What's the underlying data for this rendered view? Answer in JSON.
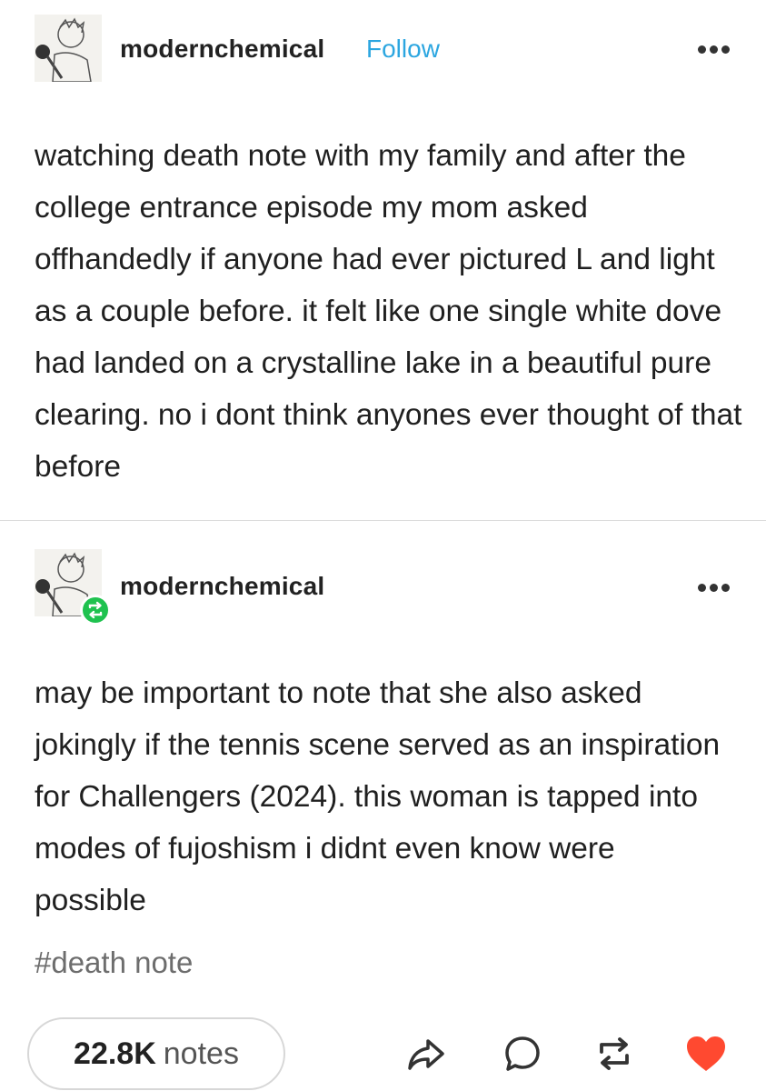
{
  "post": {
    "username": "modernchemical",
    "follow_label": "Follow",
    "text": "watching death note with my family and after the college entrance episode my mom asked offhandedly if anyone had ever pictured L and light as a couple before. it felt like one single white dove had landed on a crystalline lake in a beautiful pure clearing. no i dont think anyones ever thought of that before"
  },
  "reblog": {
    "username": "modernchemical",
    "text": "may be important to note that she also asked jokingly if the tennis scene served as an inspiration for Challengers (2024). this woman is tapped into modes of fujoshism i didnt even know were possible",
    "tag": "#death note"
  },
  "footer": {
    "notes_count": "22.8K",
    "notes_label": "notes"
  },
  "icons": {
    "share": "share-icon",
    "reply": "reply-icon",
    "reblog": "reblog-icon",
    "like": "heart-icon",
    "more": "more-icon"
  },
  "colors": {
    "follow": "#2ca6e0",
    "reblog_badge": "#1fc24f",
    "heart": "#ff4930"
  }
}
